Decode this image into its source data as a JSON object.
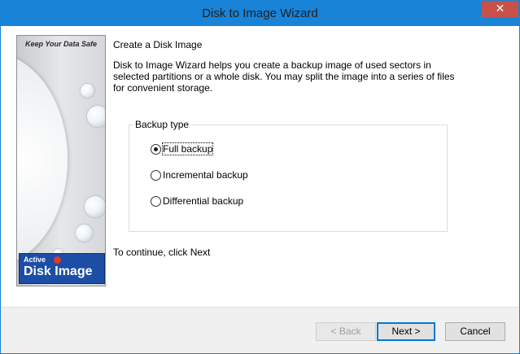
{
  "window": {
    "title": "Disk to Image Wizard",
    "close_glyph": "✕"
  },
  "banner": {
    "tagline": "Keep Your Data Safe",
    "logo_small": "Active",
    "logo_big": "Disk Image"
  },
  "main": {
    "heading": "Create a Disk Image",
    "description": "Disk to Image Wizard helps you create a backup image of used sectors in selected partitions or a whole disk. You may split the image into a series of files for convenient storage.",
    "backup_type": {
      "legend": "Backup type",
      "options": [
        {
          "label": "Full backup",
          "selected": true
        },
        {
          "label": "Incremental backup",
          "selected": false
        },
        {
          "label": "Differential backup",
          "selected": false
        }
      ]
    },
    "continue_hint": "To continue, click Next"
  },
  "buttons": {
    "back": "< Back",
    "next": "Next >",
    "cancel": "Cancel"
  },
  "colors": {
    "titlebar": "#1883d7",
    "close_button": "#c7504a",
    "logo_background": "#1d4ea6"
  }
}
